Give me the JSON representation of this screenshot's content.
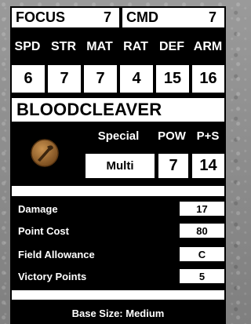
{
  "focus": {
    "label": "FOCUS",
    "value": "7"
  },
  "cmd": {
    "label": "CMD",
    "value": "7"
  },
  "stat_headers": [
    "SPD",
    "STR",
    "MAT",
    "RAT",
    "DEF",
    "ARM"
  ],
  "stat_values": [
    "6",
    "7",
    "7",
    "4",
    "15",
    "16"
  ],
  "weapon": {
    "name": "BLOODCLEAVER",
    "icon": "melee-weapon-icon",
    "headers": {
      "special": "Special",
      "pow": "POW",
      "ps": "P+S"
    },
    "special": "Multi",
    "pow": "7",
    "ps": "14"
  },
  "rows": [
    {
      "label": "Damage",
      "value": "17"
    },
    {
      "label": "Point Cost",
      "value": "80"
    },
    {
      "label": "Field Allowance",
      "value": "C"
    },
    {
      "label": "Victory Points",
      "value": "5"
    }
  ],
  "base_size": "Base Size: Medium"
}
